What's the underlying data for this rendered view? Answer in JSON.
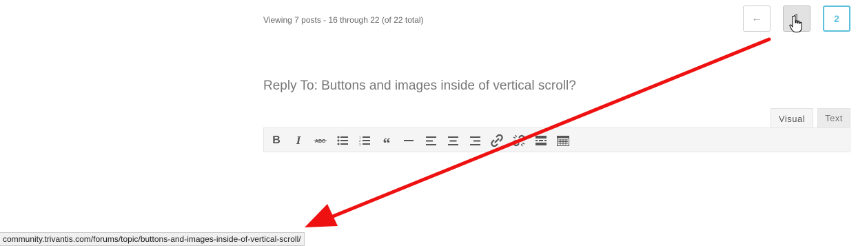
{
  "pagination": {
    "viewing_text": "Viewing 7 posts - 16 through 22 (of 22 total)",
    "prev_label": "←",
    "page1_label": "1",
    "page2_label": "2"
  },
  "reply": {
    "title": "Reply To: Buttons and images inside of vertical scroll?"
  },
  "editor": {
    "tabs": [
      "Visual",
      "Text"
    ],
    "toolbar": [
      {
        "icon": "bold-icon"
      },
      {
        "icon": "italic-icon"
      },
      {
        "icon": "strikethrough-icon"
      },
      {
        "icon": "bullet-list-icon"
      },
      {
        "icon": "numbered-list-icon"
      },
      {
        "icon": "blockquote-icon"
      },
      {
        "icon": "horizontal-line-icon"
      },
      {
        "icon": "align-left-icon"
      },
      {
        "icon": "align-center-icon"
      },
      {
        "icon": "align-right-icon"
      },
      {
        "icon": "link-icon"
      },
      {
        "icon": "unlink-icon"
      },
      {
        "icon": "read-more-icon"
      },
      {
        "icon": "toolbar-toggle-icon"
      }
    ]
  },
  "status_bar": {
    "url": "community.trivantis.com/forums/topic/buttons-and-images-inside-of-vertical-scroll/"
  },
  "colors": {
    "accent": "#5bc0de",
    "annotation_arrow": "#ee1111"
  }
}
